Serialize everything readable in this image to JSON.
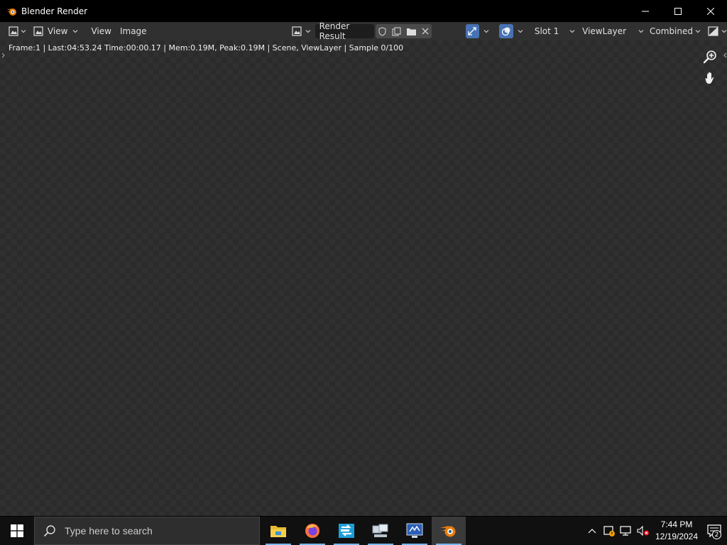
{
  "window": {
    "title": "Blender Render"
  },
  "header": {
    "view_menu": "View",
    "menu_view": "View",
    "menu_image": "Image",
    "image_name": "Render Result",
    "slot": "Slot 1",
    "view_layer": "ViewLayer",
    "pass": "Combined"
  },
  "viewport": {
    "stats": "Frame:1 | Last:04:53.24 Time:00:00.17 | Mem:0.19M, Peak:0.19M | Scene, ViewLayer | Sample 0/100"
  },
  "taskbar": {
    "search_placeholder": "Type here to search",
    "time": "7:44 PM",
    "date": "12/19/2024",
    "notification_count": "2"
  },
  "colors": {
    "header_bg": "#303030",
    "accent_blue": "#4772b3",
    "blender_orange": "#e87d0d"
  }
}
